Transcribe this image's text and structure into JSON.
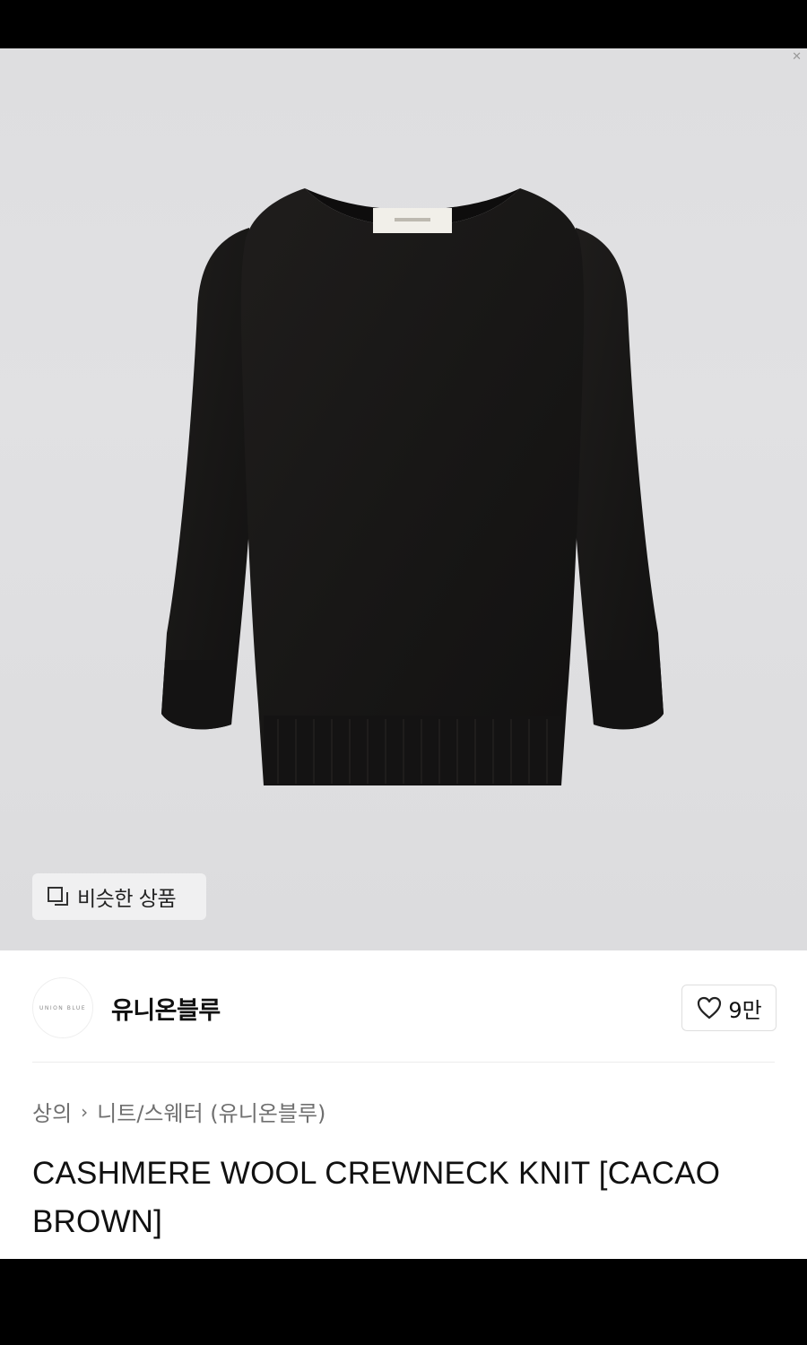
{
  "similar_products": {
    "label": "비슷한 상품"
  },
  "brand": {
    "name": "유니온블루",
    "logo_text": "UNION BLUE",
    "likes": "9만"
  },
  "breadcrumb": {
    "category": "상의",
    "separator": "›",
    "subcategory": "니트/스웨터 (유니온블루)"
  },
  "product": {
    "title": "CASHMERE WOOL CREWNECK KNIT [CACAO BROWN]"
  }
}
